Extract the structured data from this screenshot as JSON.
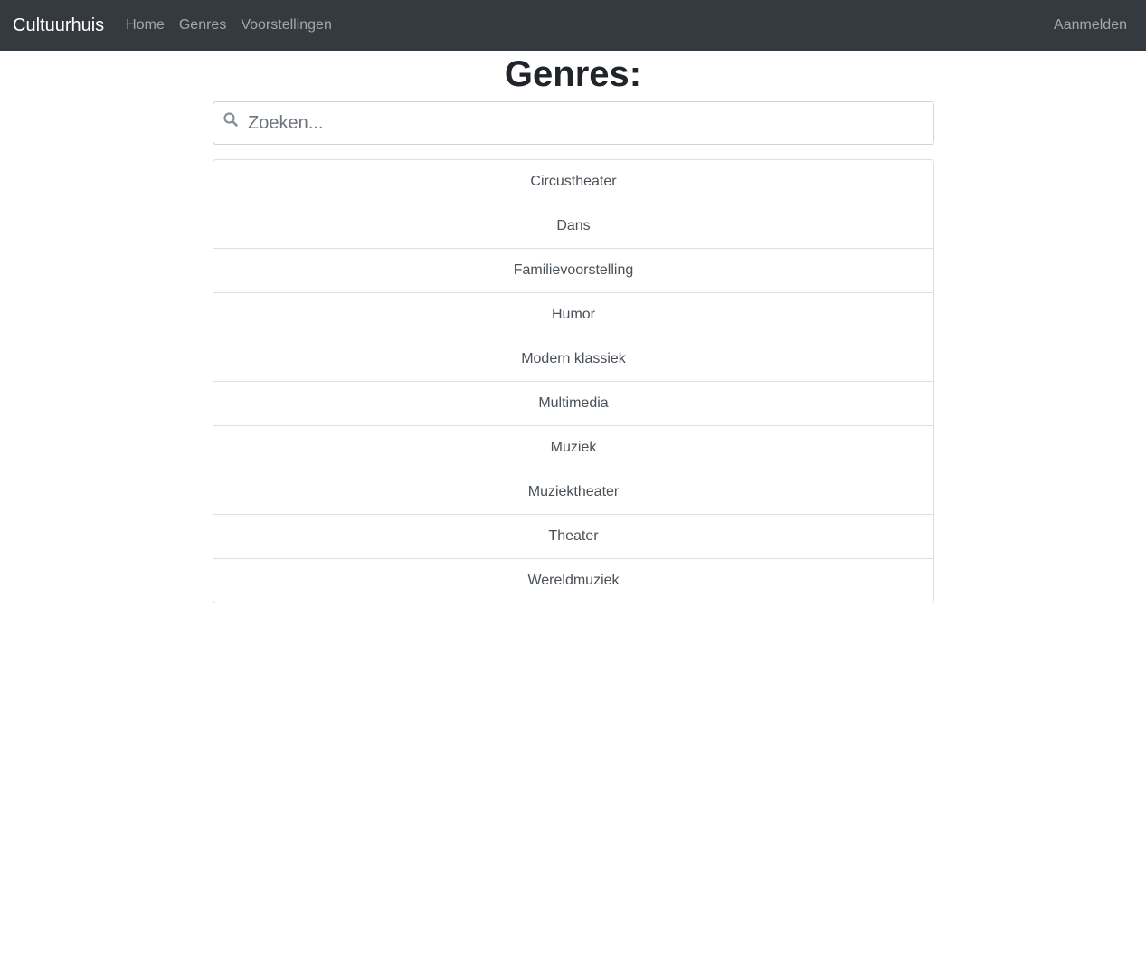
{
  "navbar": {
    "brand": "Cultuurhuis",
    "links": [
      {
        "label": "Home"
      },
      {
        "label": "Genres"
      },
      {
        "label": "Voorstellingen"
      }
    ],
    "login_label": "Aanmelden"
  },
  "page": {
    "title": "Genres:"
  },
  "search": {
    "placeholder": "Zoeken...",
    "value": "",
    "icon": "search-icon"
  },
  "genres": [
    {
      "label": "Circustheater"
    },
    {
      "label": "Dans"
    },
    {
      "label": "Familievoorstelling"
    },
    {
      "label": "Humor"
    },
    {
      "label": "Modern klassiek"
    },
    {
      "label": "Multimedia"
    },
    {
      "label": "Muziek"
    },
    {
      "label": "Muziektheater"
    },
    {
      "label": "Theater"
    },
    {
      "label": "Wereldmuziek"
    }
  ],
  "colors": {
    "navbar_bg": "#343a40",
    "border": "#dfdfdf"
  }
}
